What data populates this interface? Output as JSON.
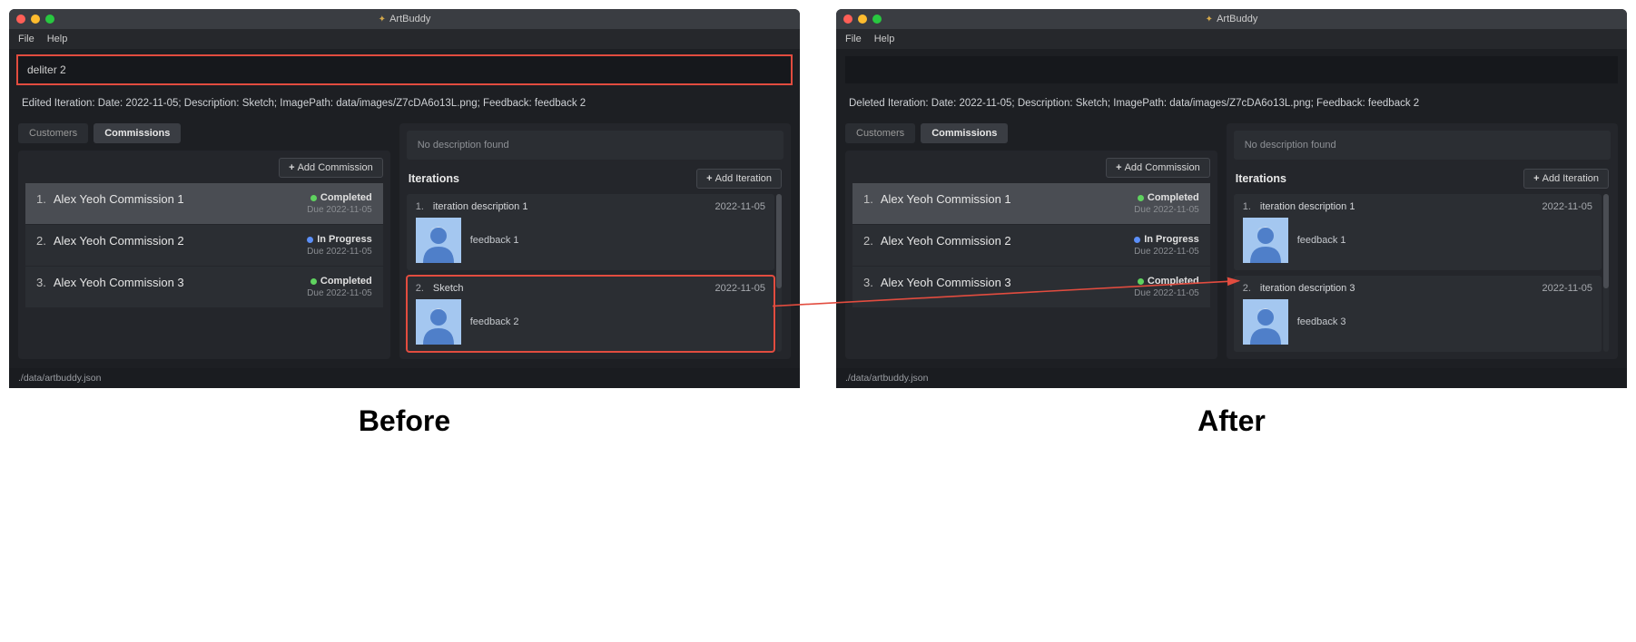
{
  "captions": {
    "before": "Before",
    "after": "After"
  },
  "app": {
    "title": "ArtBuddy",
    "menu": [
      "File",
      "Help"
    ],
    "footer": "./data/artbuddy.json"
  },
  "traffic": [
    "red",
    "yellow",
    "green"
  ],
  "before": {
    "command": "deliter 2",
    "status": "Edited Iteration: Date: 2022-11-05; Description: Sketch; ImagePath: data/images/Z7cDA6o13L.png; Feedback: feedback 2",
    "tabs": [
      {
        "label": "Customers",
        "active": false
      },
      {
        "label": "Commissions",
        "active": true
      }
    ],
    "add_commission": "Add Commission",
    "commissions": [
      {
        "idx": "1.",
        "title": "Alex Yeoh Commission 1",
        "status": "Completed",
        "dot": "green",
        "due": "Due 2022-11-05",
        "sel": true
      },
      {
        "idx": "2.",
        "title": "Alex Yeoh Commission 2",
        "status": "In Progress",
        "dot": "blue",
        "due": "Due 2022-11-05",
        "sel": false
      },
      {
        "idx": "3.",
        "title": "Alex Yeoh Commission 3",
        "status": "Completed",
        "dot": "green",
        "due": "Due 2022-11-05",
        "sel": false
      }
    ],
    "no_desc": "No description found",
    "iter_title": "Iterations",
    "add_iteration": "Add Iteration",
    "iterations": [
      {
        "idx": "1.",
        "desc": "iteration description 1",
        "date": "2022-11-05",
        "feedback": "feedback 1",
        "hl": false
      },
      {
        "idx": "2.",
        "desc": "Sketch",
        "date": "2022-11-05",
        "feedback": "feedback 2",
        "hl": true
      }
    ]
  },
  "after": {
    "command": "",
    "status": "Deleted Iteration: Date: 2022-11-05; Description: Sketch; ImagePath: data/images/Z7cDA6o13L.png; Feedback: feedback 2",
    "tabs": [
      {
        "label": "Customers",
        "active": false
      },
      {
        "label": "Commissions",
        "active": true
      }
    ],
    "add_commission": "Add Commission",
    "commissions": [
      {
        "idx": "1.",
        "title": "Alex Yeoh Commission 1",
        "status": "Completed",
        "dot": "green",
        "due": "Due 2022-11-05",
        "sel": true
      },
      {
        "idx": "2.",
        "title": "Alex Yeoh Commission 2",
        "status": "In Progress",
        "dot": "blue",
        "due": "Due 2022-11-05",
        "sel": false
      },
      {
        "idx": "3.",
        "title": "Alex Yeoh Commission 3",
        "status": "Completed",
        "dot": "green",
        "due": "Due 2022-11-05",
        "sel": false
      }
    ],
    "no_desc": "No description found",
    "iter_title": "Iterations",
    "add_iteration": "Add Iteration",
    "iterations": [
      {
        "idx": "1.",
        "desc": "iteration description 1",
        "date": "2022-11-05",
        "feedback": "feedback 1",
        "hl": false
      },
      {
        "idx": "2.",
        "desc": "iteration description 3",
        "date": "2022-11-05",
        "feedback": "feedback 3",
        "hl": false
      }
    ]
  }
}
